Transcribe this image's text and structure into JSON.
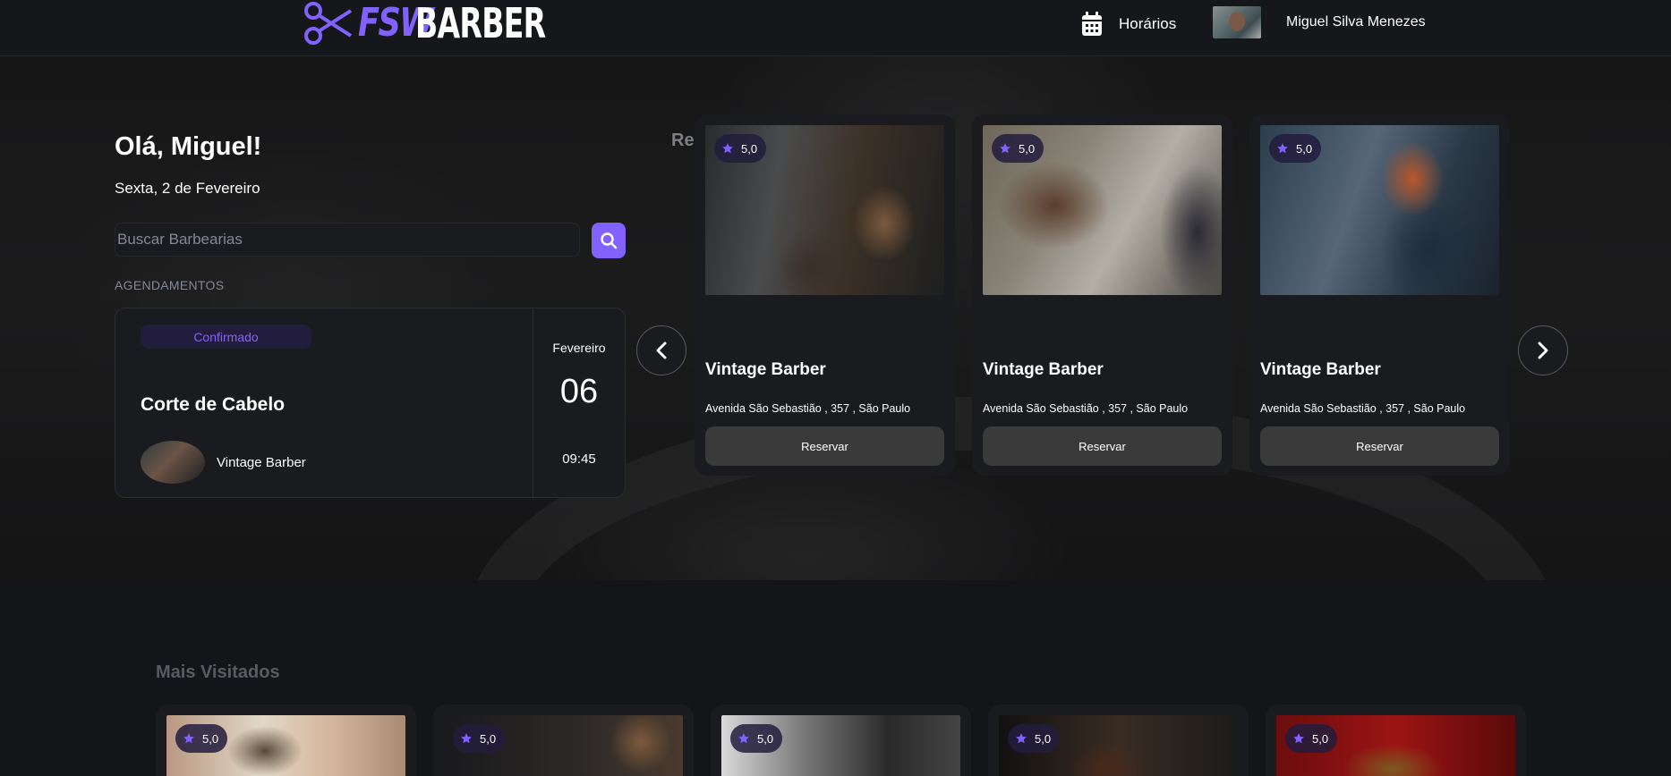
{
  "header": {
    "logo_prefix": "FSW",
    "logo_suffix": "BARBER",
    "nav_schedules": "Horários",
    "user_name": "Miguel Silva Menezes"
  },
  "hero": {
    "greeting": "Olá, Miguel!",
    "date": "Sexta, 2 de Fevereiro",
    "search_placeholder": "Buscar Barbearias",
    "section_label": "AGENDAMENTOS",
    "booking": {
      "status": "Confirmado",
      "service": "Corte de Cabelo",
      "shop": "Vintage Barber",
      "month": "Fevereiro",
      "day": "06",
      "time": "09:45"
    }
  },
  "recommended": {
    "title": "Recomendados",
    "cards": [
      {
        "rating": "5,0",
        "name": "Vintage Barber",
        "address": "Avenida São Sebastião , 357 , São Paulo",
        "button": "Reservar"
      },
      {
        "rating": "5,0",
        "name": "Vintage Barber",
        "address": "Avenida São Sebastião , 357 , São Paulo",
        "button": "Reservar"
      },
      {
        "rating": "5,0",
        "name": "Vintage Barber",
        "address": "Avenida São Sebastião , 357 , São Paulo",
        "button": "Reservar"
      }
    ]
  },
  "most_visited": {
    "title": "Mais Visitados",
    "cards": [
      {
        "rating": "5,0"
      },
      {
        "rating": "5,0"
      },
      {
        "rating": "5,0"
      },
      {
        "rating": "5,0"
      },
      {
        "rating": "5,0"
      }
    ]
  },
  "colors": {
    "accent": "#8162ff",
    "background": "#141519",
    "card": "#1a1b1f",
    "button": "#3a3a3b",
    "badge_bg": "#221c3d"
  },
  "icons": {
    "logo": "scissors-icon",
    "schedules": "calendar-icon",
    "search": "search-icon",
    "rating": "star-icon",
    "prev": "chevron-left-icon",
    "next": "chevron-right-icon"
  }
}
